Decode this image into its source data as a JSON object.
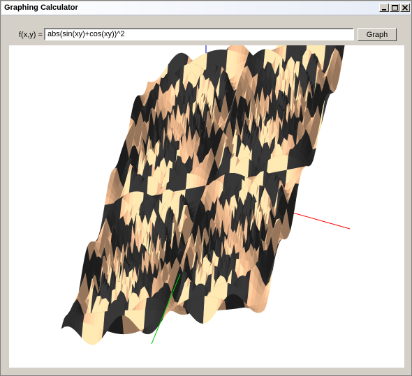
{
  "window": {
    "title": "Graphing Calculator"
  },
  "controls": {
    "function_label": "f(x,y) =",
    "function_value": "abs(sin(xy)+cos(xy))^2",
    "graph_button_label": "Graph"
  },
  "plot": {
    "axis_colors": {
      "x": "#ff0000",
      "y": "#00cc00",
      "z": "#0000cc"
    },
    "surface_colors": {
      "light": "#e8b48a",
      "dark": "#2b2b2b"
    }
  }
}
